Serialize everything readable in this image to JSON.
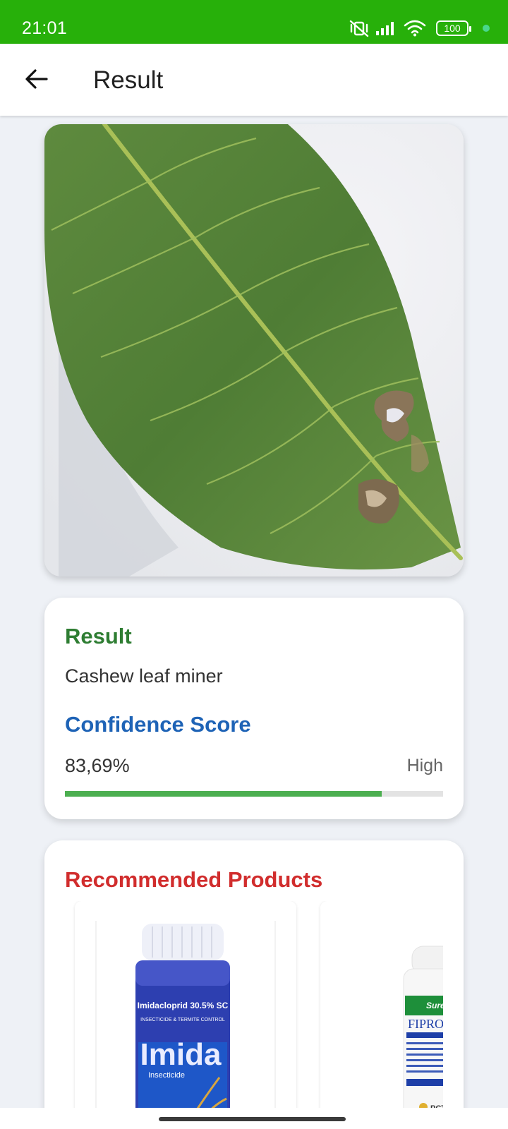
{
  "status_bar": {
    "time": "21:01",
    "battery": "100",
    "icons": [
      "mute-vibrate-icon",
      "signal-icon",
      "wifi-icon",
      "battery-icon",
      "notification-dot-icon"
    ]
  },
  "app_bar": {
    "title": "Result",
    "back_icon": "arrow-left-icon"
  },
  "leaf_image": {
    "description_icon": "leaf-photo"
  },
  "result": {
    "heading": "Result",
    "value": "Cashew leaf miner",
    "confidence_heading": "Confidence Score",
    "confidence_value": "83,69%",
    "confidence_level": "High",
    "confidence_fraction": 0.8369
  },
  "products": {
    "heading": "Recommended Products",
    "items": [
      {
        "bottle_label_line1": "Imidacloprid 30.5% SC",
        "bottle_label_line2": "INSECTICIDE & TERMITE CONTROL",
        "bottle_brand": "Imida",
        "bottle_type": "Insecticide"
      },
      {
        "bottle_brand": "SureFire",
        "bottle_name": "FIPRONI",
        "bottle_maker": "PCT"
      }
    ]
  },
  "colors": {
    "status_bar": "#27b00a",
    "result_heading": "#2e7d32",
    "confidence_heading": "#1e63b6",
    "products_heading": "#d12d2d",
    "progress_fill": "#4caf50"
  }
}
